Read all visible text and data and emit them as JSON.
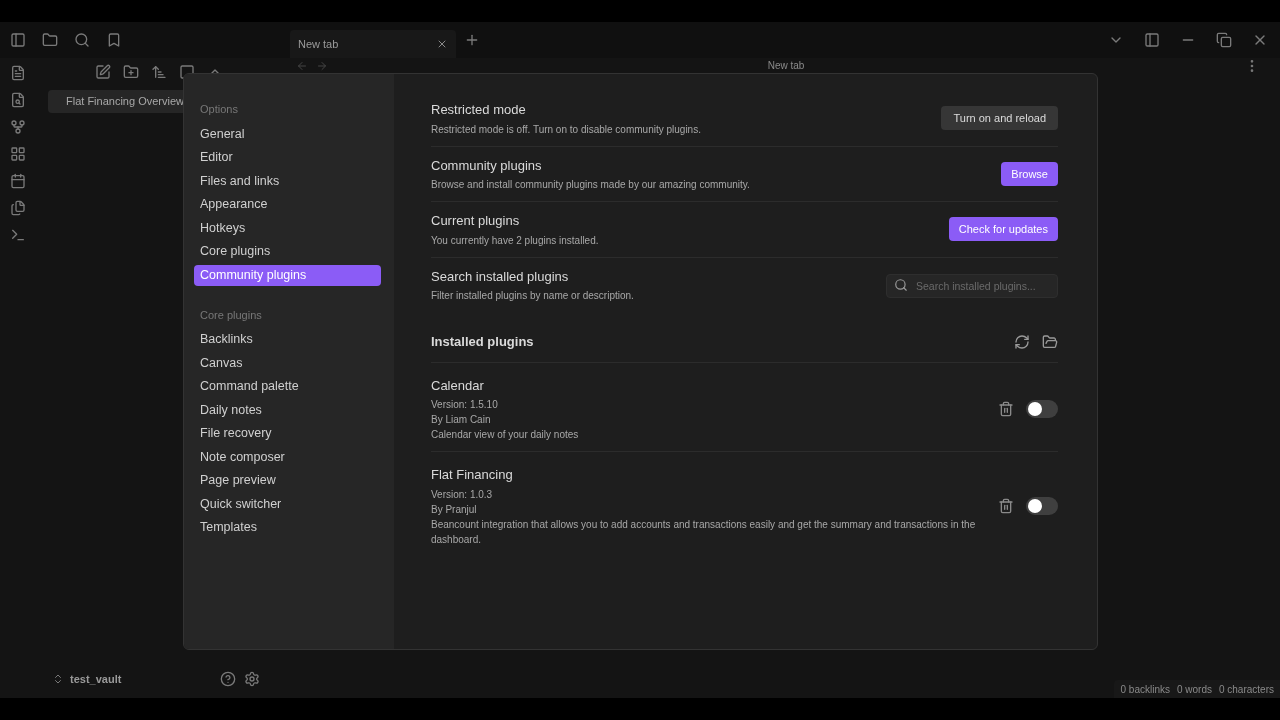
{
  "tab": {
    "title": "New tab"
  },
  "file_explorer": {
    "items": [
      {
        "label": "Flat Financing Overview",
        "selected": true
      }
    ],
    "vault": "test_vault"
  },
  "editor": {
    "title": "New tab"
  },
  "status_bar": [
    "0 backlinks",
    "0 words",
    "0 characters"
  ],
  "settings": {
    "nav": [
      {
        "heading": "Options",
        "items": [
          {
            "label": "General",
            "selected": false
          },
          {
            "label": "Editor",
            "selected": false
          },
          {
            "label": "Files and links",
            "selected": false
          },
          {
            "label": "Appearance",
            "selected": false
          },
          {
            "label": "Hotkeys",
            "selected": false
          },
          {
            "label": "Core plugins",
            "selected": false
          },
          {
            "label": "Community plugins",
            "selected": true
          }
        ]
      },
      {
        "heading": "Core plugins",
        "items": [
          {
            "label": "Backlinks",
            "selected": false
          },
          {
            "label": "Canvas",
            "selected": false
          },
          {
            "label": "Command palette",
            "selected": false
          },
          {
            "label": "Daily notes",
            "selected": false
          },
          {
            "label": "File recovery",
            "selected": false
          },
          {
            "label": "Note composer",
            "selected": false
          },
          {
            "label": "Page preview",
            "selected": false
          },
          {
            "label": "Quick switcher",
            "selected": false
          },
          {
            "label": "Templates",
            "selected": false
          }
        ]
      }
    ],
    "rows": [
      {
        "kind": "button",
        "name": "Restricted mode",
        "description": "Restricted mode is off. Turn on to disable community plugins.",
        "control": "Turn on and reload"
      },
      {
        "kind": "primary",
        "name": "Community plugins",
        "description": "Browse and install community plugins made by our amazing community.",
        "control": "Browse"
      },
      {
        "kind": "primary",
        "name": "Current plugins",
        "description": "You currently have 2 plugins installed.",
        "control": "Check for updates"
      },
      {
        "kind": "search",
        "name": "Search installed plugins",
        "description": "Filter installed plugins by name or description.",
        "placeholder": "Search installed plugins..."
      }
    ],
    "installed_heading": "Installed plugins",
    "plugins": [
      {
        "name": "Calendar",
        "version": "Version: 1.5.10",
        "author": "By Liam Cain",
        "description": "Calendar view of your daily notes",
        "enabled": false
      },
      {
        "name": "Flat Financing",
        "version": "Version: 1.0.3",
        "author": "By Pranjul",
        "description": "Beancount integration that allows you to add accounts and transactions easily and get the summary and transactions in the dashboard.",
        "enabled": false
      }
    ]
  }
}
